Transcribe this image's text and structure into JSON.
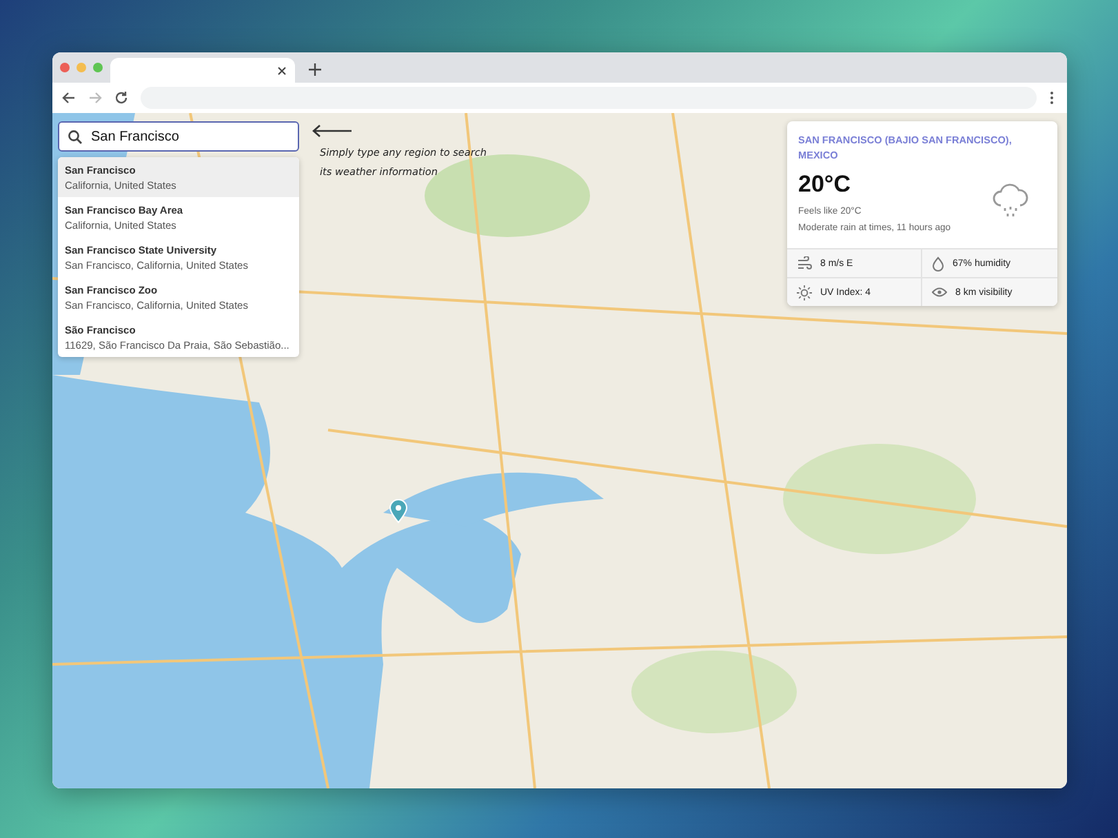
{
  "search": {
    "value": "San Francisco",
    "suggestions": [
      {
        "title": "San Francisco",
        "subtitle": "California, United States",
        "selected": true
      },
      {
        "title": "San Francisco Bay Area",
        "subtitle": "California, United States",
        "selected": false
      },
      {
        "title": "San Francisco State University",
        "subtitle": "San Francisco, California, United States",
        "selected": false
      },
      {
        "title": "San Francisco Zoo",
        "subtitle": "San Francisco, California, United States",
        "selected": false
      },
      {
        "title": "São Francisco",
        "subtitle": "11629, São Francisco Da Praia, São Sebastião...",
        "selected": false
      }
    ]
  },
  "hint": "Simply type any region to search its weather information",
  "weather": {
    "location": "SAN FRANCISCO (BAJIO SAN FRANCISCO), MEXICO",
    "temperature": "20°C",
    "feels_like": "Feels like 20°C",
    "description": "Moderate rain at times, 11 hours ago",
    "stats": [
      {
        "kind": "wind",
        "text": "8 m/s E"
      },
      {
        "kind": "humidity",
        "text": "67% humidity"
      },
      {
        "kind": "uv",
        "text": "UV Index: 4"
      },
      {
        "kind": "visibility",
        "text": "8 km visibility"
      }
    ]
  }
}
